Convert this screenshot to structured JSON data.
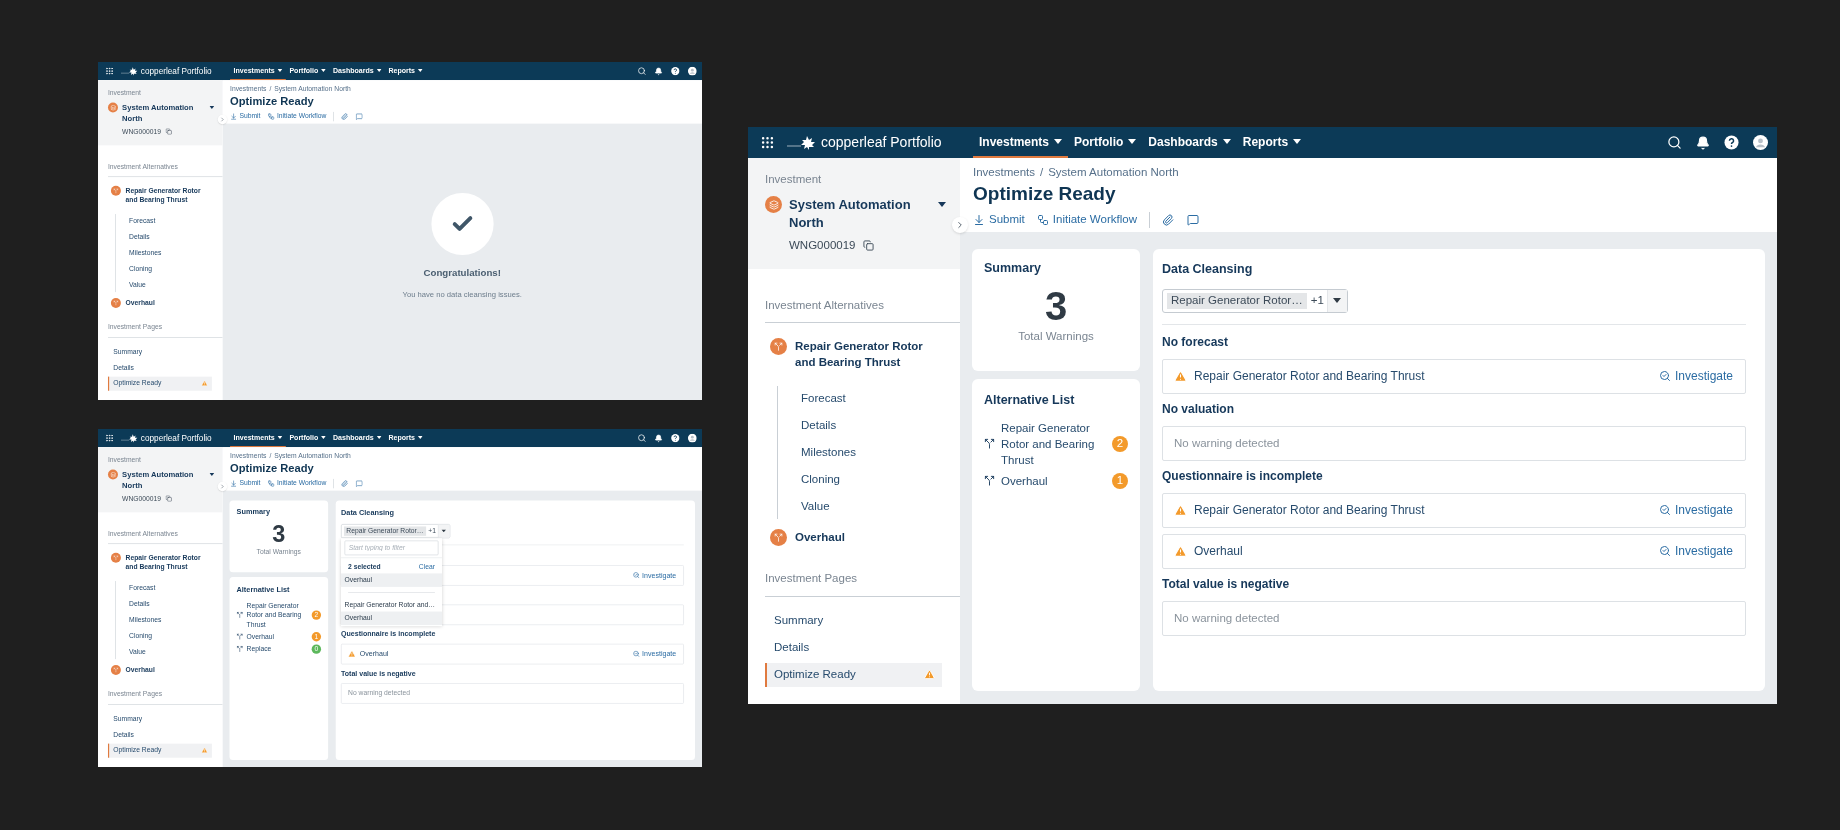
{
  "screens": [
    {
      "nav": {
        "brand": "copperleaf Portfolio",
        "menus": [
          {
            "label": "Investments",
            "selected": true
          },
          {
            "label": "Portfolio",
            "selected": false
          },
          {
            "label": "Dashboards",
            "selected": false
          },
          {
            "label": "Reports",
            "selected": false
          }
        ]
      },
      "sidebar": {
        "section_label": "Investment",
        "investment": "System Automation North",
        "code": "WNG000019",
        "alternatives_label": "Investment Alternatives",
        "alternatives": [
          {
            "label": "Repair Generator Rotor and Bearing Thrust",
            "children": [
              {
                "label": "Forecast"
              },
              {
                "label": "Details"
              },
              {
                "label": "Milestones"
              },
              {
                "label": "Cloning"
              },
              {
                "label": "Value"
              }
            ]
          },
          {
            "label": "Overhaul"
          }
        ],
        "pages_label": "Investment Pages",
        "pages": [
          {
            "label": "Summary",
            "selected": false,
            "warning": false
          },
          {
            "label": "Details",
            "selected": false,
            "warning": false
          },
          {
            "label": "Optimize Ready",
            "selected": true,
            "warning": true
          }
        ]
      },
      "header": {
        "breadcrumb": [
          "Investments",
          "System Automation North"
        ],
        "separator": "/",
        "title": "Optimize Ready",
        "actions": [
          "Submit",
          "Initiate Workflow"
        ]
      },
      "main": {
        "kind": "success",
        "title": "Congratulations!",
        "message": "You have no data cleansing issues."
      }
    },
    {
      "nav": {
        "brand": "copperleaf Portfolio",
        "menus": [
          {
            "label": "Investments",
            "selected": true
          },
          {
            "label": "Portfolio",
            "selected": false
          },
          {
            "label": "Dashboards",
            "selected": false
          },
          {
            "label": "Reports",
            "selected": false
          }
        ]
      },
      "sidebar": {
        "section_label": "Investment",
        "investment": "System Automation North",
        "code": "WNG000019",
        "alternatives_label": "Investment Alternatives",
        "alternatives": [
          {
            "label": "Repair Generator Rotor and Bearing Thrust",
            "children": [
              {
                "label": "Forecast"
              },
              {
                "label": "Details"
              },
              {
                "label": "Milestones"
              },
              {
                "label": "Cloning"
              },
              {
                "label": "Value"
              }
            ]
          },
          {
            "label": "Overhaul"
          }
        ],
        "pages_label": "Investment Pages",
        "pages": [
          {
            "label": "Summary",
            "selected": false,
            "warning": false
          },
          {
            "label": "Details",
            "selected": false,
            "warning": false
          },
          {
            "label": "Optimize Ready",
            "selected": true,
            "warning": true
          }
        ]
      },
      "header": {
        "breadcrumb": [
          "Investments",
          "System Automation North"
        ],
        "separator": "/",
        "title": "Optimize Ready",
        "actions": [
          "Submit",
          "Initiate Workflow"
        ]
      },
      "main": {
        "kind": "cleansing",
        "summary": {
          "title": "Summary",
          "count": "3",
          "caption": "Total Warnings"
        },
        "alternative_list": {
          "title": "Alternative List",
          "items": [
            {
              "label": "Repair Generator Rotor and Bearing Thrust",
              "count": "2",
              "color": "#f39a2b"
            },
            {
              "label": "Overhaul",
              "count": "1",
              "color": "#f39a2b"
            },
            {
              "label": "Replace",
              "count": "0",
              "color": "#5cb85c"
            }
          ]
        },
        "cleansing": {
          "title": "Data Cleansing",
          "chip": "Repair Generator Rotor…",
          "more": "+1",
          "dropdown": {
            "placeholder": "Start typing to filter",
            "selected_count": "2 selected",
            "clear": "Clear",
            "pinned": [
              {
                "label": "Overhaul",
                "selected": true
              }
            ],
            "options": [
              {
                "label": "Repair Generator Rotor and…",
                "selected": false
              },
              {
                "label": "Overhaul",
                "selected": true
              }
            ]
          },
          "sections": [
            {
              "rows": [
                {
                  "kind": "warning",
                  "action": "Investigate"
                }
              ]
            },
            {
              "rows": [
                {
                  "kind": "empty"
                }
              ]
            },
            {
              "title": "Questionnaire is incomplete",
              "rows": [
                {
                  "kind": "warning",
                  "text": "Overhaul",
                  "action": "Investigate"
                }
              ]
            },
            {
              "title": "Total value is negative",
              "rows": [
                {
                  "kind": "empty",
                  "text": "No warning detected"
                }
              ]
            }
          ]
        }
      }
    },
    {
      "nav": {
        "brand": "copperleaf Portfolio",
        "menus": [
          {
            "label": "Investments",
            "selected": true
          },
          {
            "label": "Portfolio",
            "selected": false
          },
          {
            "label": "Dashboards",
            "selected": false
          },
          {
            "label": "Reports",
            "selected": false
          }
        ]
      },
      "sidebar": {
        "section_label": "Investment",
        "investment": "System Automation North",
        "code": "WNG000019",
        "alternatives_label": "Investment Alternatives",
        "alternatives": [
          {
            "label": "Repair Generator Rotor and Bearing Thrust",
            "children": [
              {
                "label": "Forecast"
              },
              {
                "label": "Details"
              },
              {
                "label": "Milestones"
              },
              {
                "label": "Cloning"
              },
              {
                "label": "Value"
              }
            ]
          },
          {
            "label": "Overhaul"
          }
        ],
        "pages_label": "Investment Pages",
        "pages": [
          {
            "label": "Summary",
            "selected": false,
            "warning": false
          },
          {
            "label": "Details",
            "selected": false,
            "warning": false
          },
          {
            "label": "Optimize Ready",
            "selected": true,
            "warning": true
          }
        ]
      },
      "header": {
        "breadcrumb": [
          "Investments",
          "System Automation North"
        ],
        "separator": "/",
        "title": "Optimize Ready",
        "actions": [
          "Submit",
          "Initiate Workflow"
        ]
      },
      "main": {
        "kind": "cleansing",
        "summary": {
          "title": "Summary",
          "count": "3",
          "caption": "Total Warnings"
        },
        "alternative_list": {
          "title": "Alternative List",
          "items": [
            {
              "label": "Repair Generator Rotor and Bearing Thrust",
              "count": "2",
              "color": "#f39a2b"
            },
            {
              "label": "Overhaul",
              "count": "1",
              "color": "#f39a2b"
            }
          ]
        },
        "cleansing": {
          "title": "Data Cleansing",
          "chip": "Repair Generator Rotor…",
          "more": "+1",
          "sections": [
            {
              "title": "No forecast",
              "rows": [
                {
                  "kind": "warning",
                  "text": "Repair Generator Rotor and Bearing Thrust",
                  "action": "Investigate"
                }
              ]
            },
            {
              "title": "No valuation",
              "rows": [
                {
                  "kind": "empty",
                  "text": "No warning detected"
                }
              ]
            },
            {
              "title": "Questionnaire is incomplete",
              "rows": [
                {
                  "kind": "warning",
                  "text": "Repair Generator Rotor and Bearing Thrust",
                  "action": "Investigate"
                },
                {
                  "kind": "warning",
                  "text": "Overhaul",
                  "action": "Investigate"
                }
              ]
            },
            {
              "title": "Total value is negative",
              "rows": [
                {
                  "kind": "empty",
                  "text": "No warning detected"
                }
              ]
            }
          ]
        }
      }
    }
  ]
}
